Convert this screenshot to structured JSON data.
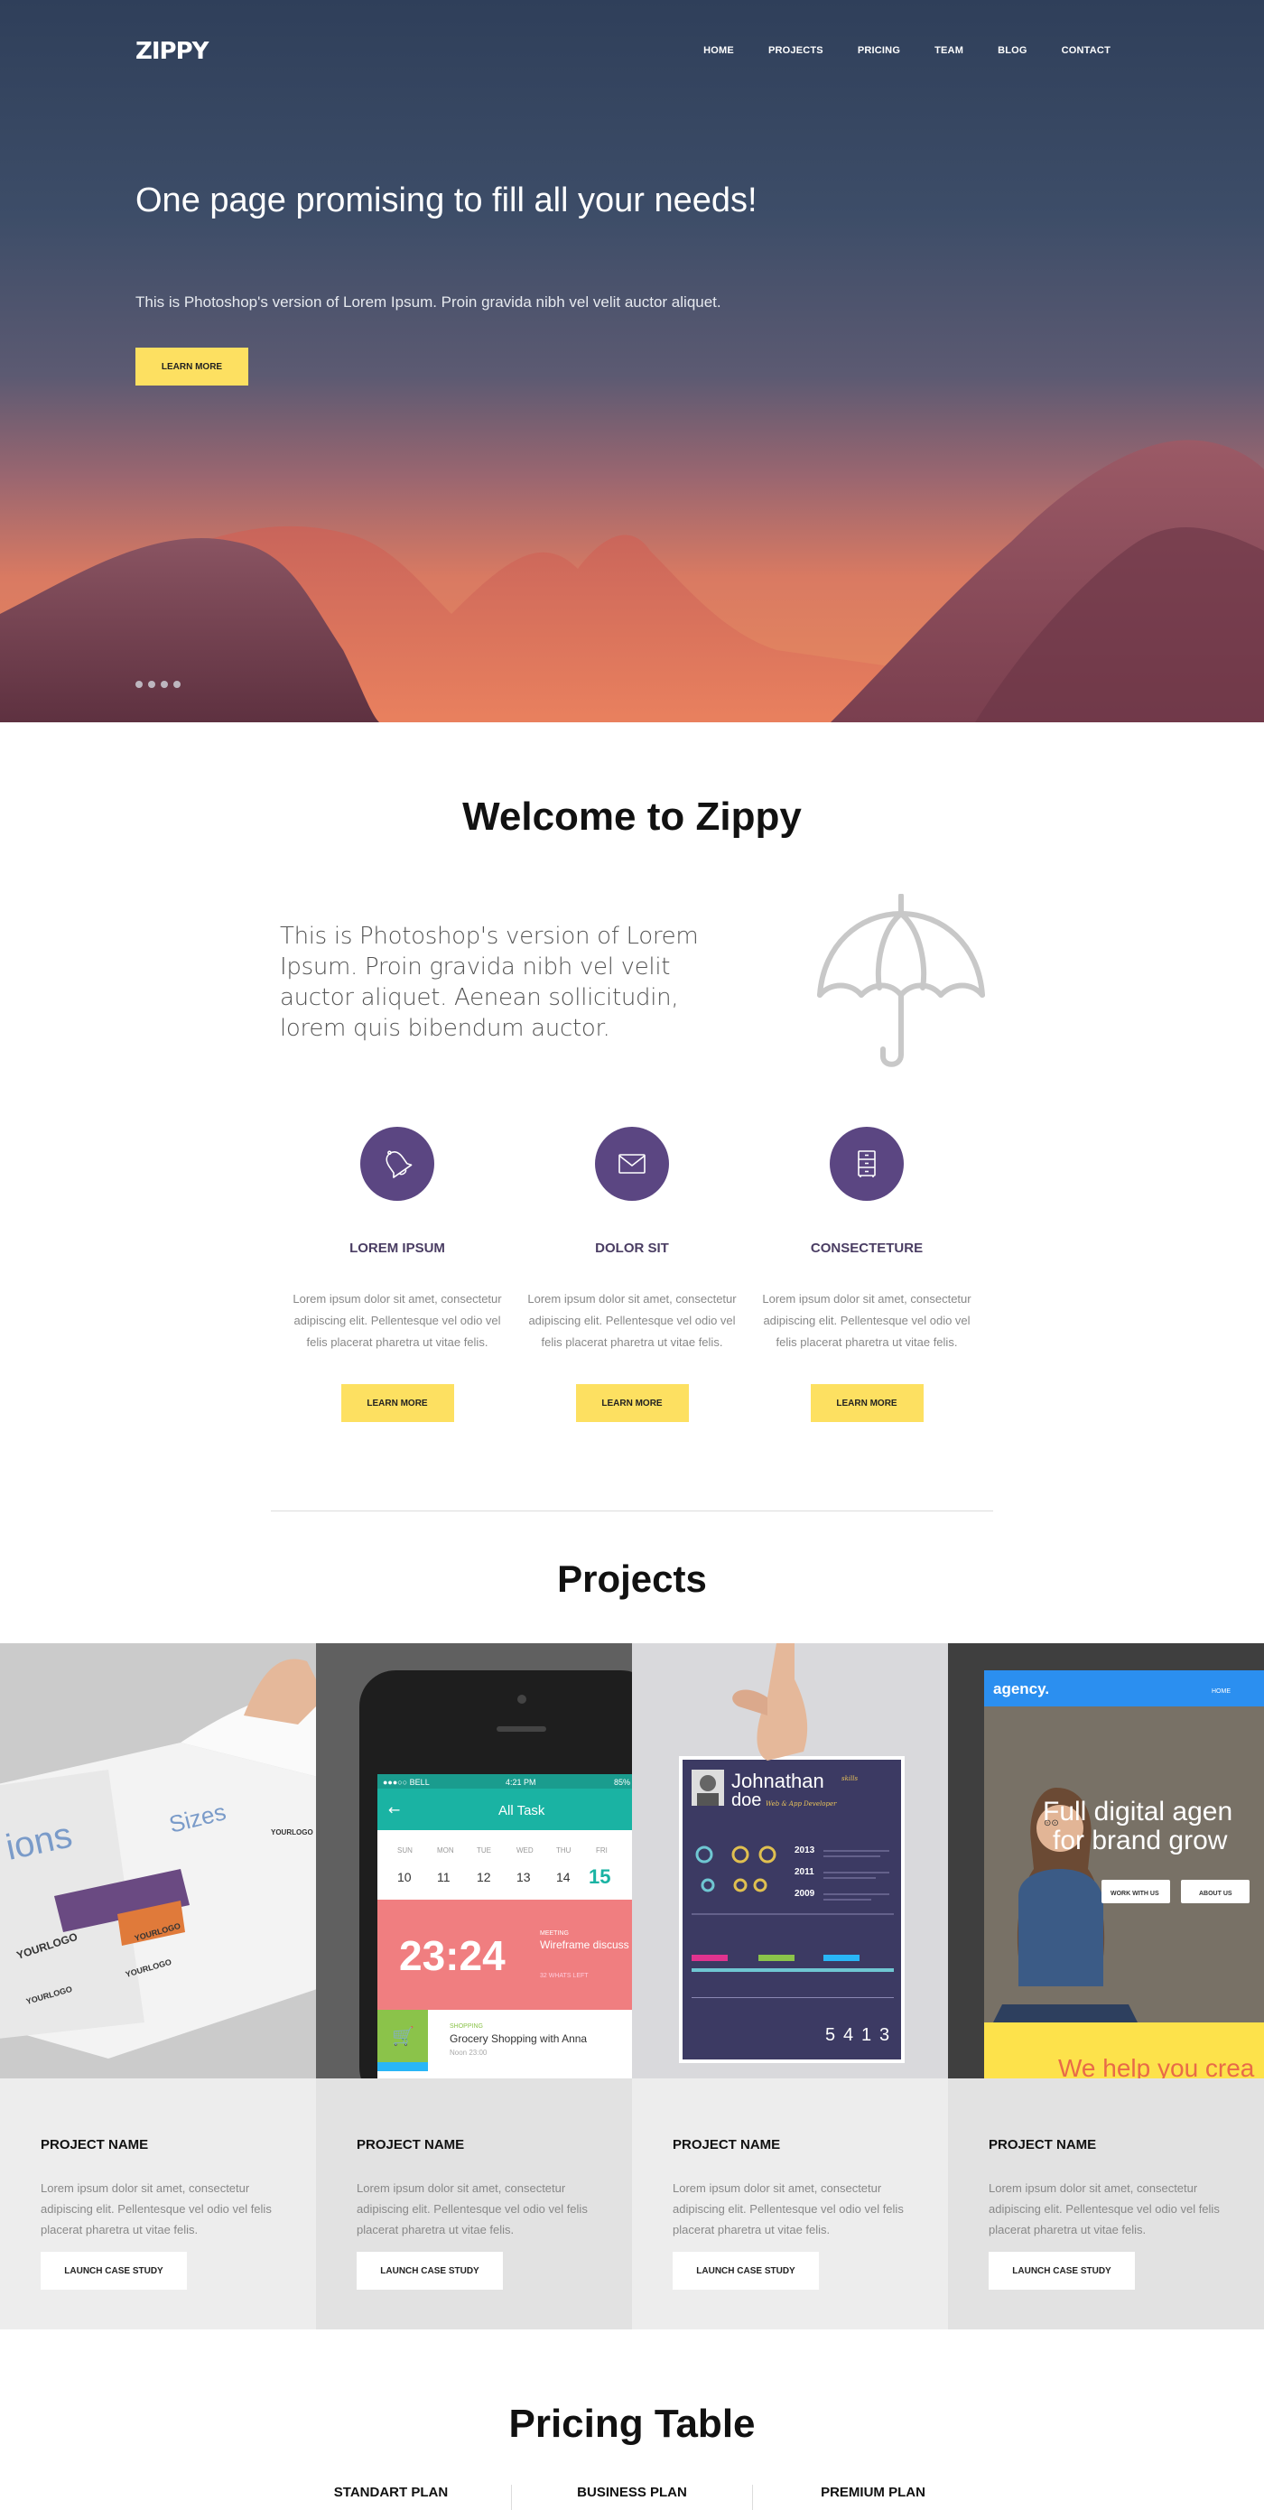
{
  "header": {
    "logo": "ZIPPY",
    "nav": [
      "HOME",
      "PROJECTS",
      "PRICING",
      "TEAM",
      "BLOG",
      "CONTACT"
    ]
  },
  "hero": {
    "title": "One page promising to fill all your needs!",
    "subtitle": "This is Photoshop's version of Lorem Ipsum. Proin gravida nibh vel velit auctor aliquet.",
    "button": "LEARN MORE",
    "slide_count": 4
  },
  "welcome": {
    "title": "Welcome to Zippy",
    "text": "This is Photoshop's version of Lorem Ipsum. Proin gravida nibh vel velit auctor aliquet. Aenean sollicitudin, lorem quis bibendum auctor.",
    "features": [
      {
        "icon": "bell-icon",
        "title": "LOREM IPSUM",
        "text": "Lorem ipsum dolor sit amet, consectetur adipiscing elit. Pellentesque vel odio vel felis placerat pharetra ut vitae felis.",
        "button": "LEARN MORE"
      },
      {
        "icon": "envelope-icon",
        "title": "DOLOR SIT",
        "text": "Lorem ipsum dolor sit amet, consectetur adipiscing elit. Pellentesque vel odio vel felis placerat pharetra ut vitae felis.",
        "button": "LEARN MORE"
      },
      {
        "icon": "cabinet-icon",
        "title": "CONSECTETURE",
        "text": "Lorem ipsum dolor sit amet, consectetur adipiscing elit. Pellentesque vel odio vel felis placerat pharetra ut vitae felis.",
        "button": "LEARN MORE"
      }
    ]
  },
  "projects": {
    "title": "Projects",
    "items": [
      {
        "name": "PROJECT NAME",
        "text": "Lorem ipsum dolor sit amet, consectetur adipiscing elit. Pellentesque vel odio vel felis placerat pharetra ut vitae felis.",
        "button": "LAUNCH CASE STUDY"
      },
      {
        "name": "PROJECT NAME",
        "text": "Lorem ipsum dolor sit amet, consectetur adipiscing elit. Pellentesque vel odio vel felis placerat pharetra ut vitae felis.",
        "button": "LAUNCH CASE STUDY"
      },
      {
        "name": "PROJECT NAME",
        "text": "Lorem ipsum dolor sit amet, consectetur adipiscing elit. Pellentesque vel odio vel felis placerat pharetra ut vitae felis.",
        "button": "LAUNCH CASE STUDY"
      },
      {
        "name": "PROJECT NAME",
        "text": "Lorem ipsum dolor sit amet, consectetur adipiscing elit. Pellentesque vel odio vel felis placerat pharetra ut vitae felis.",
        "button": "LAUNCH CASE STUDY"
      }
    ],
    "images": {
      "brochure": {
        "word": "Sizes",
        "frag": "ions",
        "logo": "YOURLOGO"
      },
      "phone": {
        "carrier": "●●●○○ BELL",
        "time": "4:21 PM",
        "battery": "85%",
        "header": "All Task",
        "days": [
          "SUN",
          "MON",
          "TUE",
          "WED",
          "THU",
          "FRI"
        ],
        "dates": [
          "10",
          "11",
          "12",
          "13",
          "14",
          "15"
        ],
        "clock": "23:24",
        "meeting_tag": "MEETING",
        "meeting": "Wireframe discuss with Google team",
        "meeting_sub": "32 WHATS LEFT",
        "shopping_tag": "SHOPPING",
        "shopping": "Grocery Shopping with Anna",
        "shopping_time": "Noon 23:00"
      },
      "resume": {
        "first": "Johnathan",
        "last": "doe",
        "role": "Web & App Developer",
        "skills": "skills",
        "years": [
          "2013",
          "2011",
          "2009"
        ],
        "digits": [
          "5",
          "4",
          "1",
          "3"
        ]
      },
      "agency": {
        "brand": "agency.",
        "nav": "HOME",
        "headline1": "Full digital agen",
        "headline2": "for brand grow",
        "btn1": "WORK WITH US",
        "btn2": "ABOUT US",
        "footer": "We help you crea"
      }
    }
  },
  "pricing": {
    "title": "Pricing Table",
    "plans": [
      "STANDART PLAN",
      "BUSINESS PLAN",
      "PREMIUM PLAN"
    ]
  },
  "colors": {
    "accent_yellow": "#fde061",
    "purple": "#5b4682",
    "hero_top": "#2f3f5a",
    "hero_bottom": "#e88a5e"
  }
}
